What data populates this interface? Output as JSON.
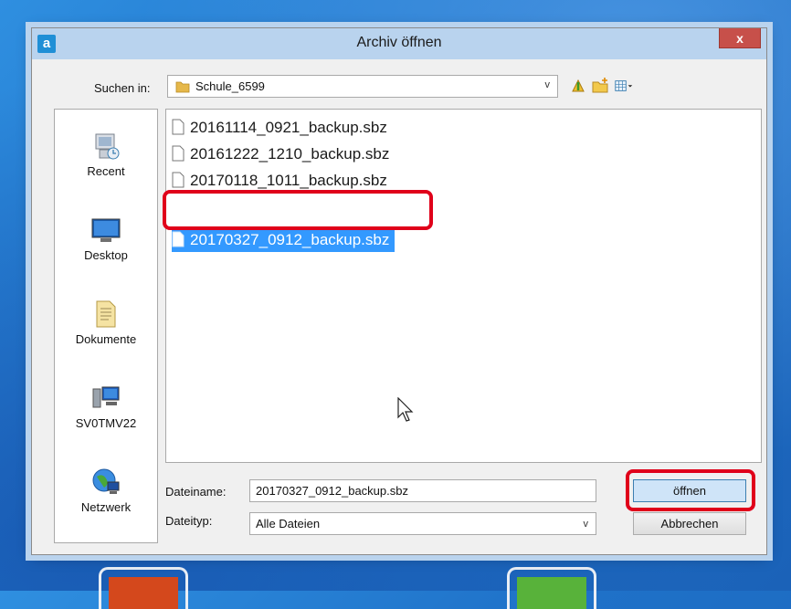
{
  "dialog": {
    "title": "Archiv öffnen",
    "app_icon_letter": "a",
    "close_label": "x"
  },
  "lookin": {
    "label": "Suchen in:",
    "value": "Schule_6599",
    "arrow": "v"
  },
  "places": [
    {
      "label": "Recent",
      "icon": "recent-icon"
    },
    {
      "label": "Desktop",
      "icon": "desktop-icon"
    },
    {
      "label": "Dokumente",
      "icon": "documents-icon"
    },
    {
      "label": "SV0TMV22",
      "icon": "computer-icon"
    },
    {
      "label": "Netzwerk",
      "icon": "network-icon"
    }
  ],
  "files": [
    {
      "name": "20161114_0921_backup.sbz",
      "selected": false
    },
    {
      "name": "20161222_1210_backup.sbz",
      "selected": false
    },
    {
      "name": "20170118_1011_backup.sbz",
      "selected": false
    },
    {
      "name": "20170327_0912_backup.sbz",
      "selected": true
    }
  ],
  "filename": {
    "label": "Dateiname:",
    "value": "20170327_0912_backup.sbz"
  },
  "filetype": {
    "label": "Dateityp:",
    "value": "Alle Dateien",
    "arrow": "v"
  },
  "buttons": {
    "open": "öffnen",
    "cancel": "Abbrechen"
  },
  "colors": {
    "highlight": "#e0001a",
    "selection": "#3399ff"
  }
}
